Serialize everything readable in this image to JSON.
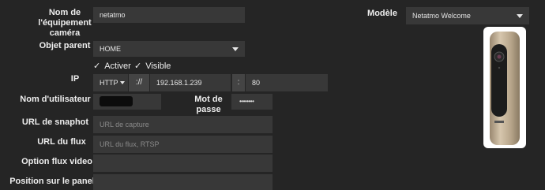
{
  "form": {
    "device_name": {
      "label": "Nom de l'équipement caméra",
      "value": "netatmo"
    },
    "parent_object": {
      "label": "Objet parent",
      "value": "HOME"
    },
    "activate": {
      "label": "Activer",
      "checked": true
    },
    "visible": {
      "label": "Visible",
      "checked": true
    },
    "ip": {
      "label": "IP",
      "protocol": "HTTP",
      "separator": "://",
      "address": "192.168.1.239",
      "port_separator": ":",
      "port": "80"
    },
    "username": {
      "label": "Nom d'utilisateur",
      "value": ""
    },
    "password": {
      "label": "Mot de passe",
      "mask": "••••••••"
    },
    "snapshot_url": {
      "label": "URL de snaphot",
      "placeholder": "URL de capture"
    },
    "stream_url": {
      "label": "URL du flux",
      "placeholder": "URL du flux, RTSP"
    },
    "stream_option": {
      "label": "Option flux video",
      "value": ""
    },
    "panel_position": {
      "label": "Position sur le panel",
      "value": ""
    }
  },
  "model": {
    "label": "Modèle",
    "value": "Netatmo Welcome"
  },
  "camera_image": {
    "brand_text": "netatmo"
  }
}
